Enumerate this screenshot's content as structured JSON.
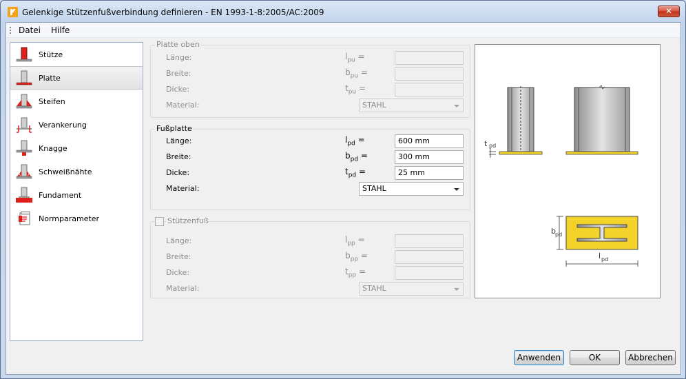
{
  "window": {
    "title": "Gelenkige Stützenfußverbindung definieren - EN 1993-1-8:2005/AC:2009",
    "close_glyph": "✕"
  },
  "menu": [
    "Datei",
    "Hilfe"
  ],
  "nav": [
    {
      "label": "Stütze",
      "icon": "column-icon"
    },
    {
      "label": "Platte",
      "icon": "plate-icon",
      "selected": true
    },
    {
      "label": "Steifen",
      "icon": "stiffener-icon"
    },
    {
      "label": "Verankerung",
      "icon": "anchor-icon"
    },
    {
      "label": "Knagge",
      "icon": "shear-key-icon"
    },
    {
      "label": "Schweißnähte",
      "icon": "weld-icon"
    },
    {
      "label": "Fundament",
      "icon": "foundation-icon"
    },
    {
      "label": "Normparameter",
      "icon": "code-parameters-icon"
    }
  ],
  "platte_oben": {
    "title": "Platte oben",
    "laenge": {
      "label": "Länge:",
      "sym": "l",
      "sub": "pu",
      "value": ""
    },
    "breite": {
      "label": "Breite:",
      "sym": "b",
      "sub": "pu",
      "value": ""
    },
    "dicke": {
      "label": "Dicke:",
      "sym": "t",
      "sub": "pu",
      "value": ""
    },
    "material": {
      "label": "Material:",
      "value": "STAHL"
    }
  },
  "fussplatte": {
    "title": "Fußplatte",
    "laenge": {
      "label": "Länge:",
      "sym": "l",
      "sub": "pd",
      "value": "600 mm"
    },
    "breite": {
      "label": "Breite:",
      "sym": "b",
      "sub": "pd",
      "value": "300 mm"
    },
    "dicke": {
      "label": "Dicke:",
      "sym": "t",
      "sub": "pd",
      "value": "25 mm"
    },
    "material": {
      "label": "Material:",
      "value": "STAHL"
    }
  },
  "stuetzenfuss": {
    "title": "Stützenfuß",
    "checked": false,
    "laenge": {
      "label": "Länge:",
      "sym": "l",
      "sub": "pp",
      "value": ""
    },
    "breite": {
      "label": "Breite:",
      "sym": "b",
      "sub": "pp",
      "value": ""
    },
    "dicke": {
      "label": "Dicke:",
      "sym": "t",
      "sub": "pp",
      "value": ""
    },
    "material": {
      "label": "Material:",
      "value": "STAHL"
    }
  },
  "equals": "=",
  "preview": {
    "t_label": "t",
    "t_sub": "pd",
    "b_label": "b",
    "b_sub": "pd",
    "l_label": "l",
    "l_sub": "pd"
  },
  "buttons": {
    "apply": "Anwenden",
    "ok": "OK",
    "cancel": "Abbrechen"
  },
  "colors": {
    "accent_red": "#e0201b",
    "plate_yellow": "#f3d22a",
    "steel_grey": "#b4b4b4"
  }
}
